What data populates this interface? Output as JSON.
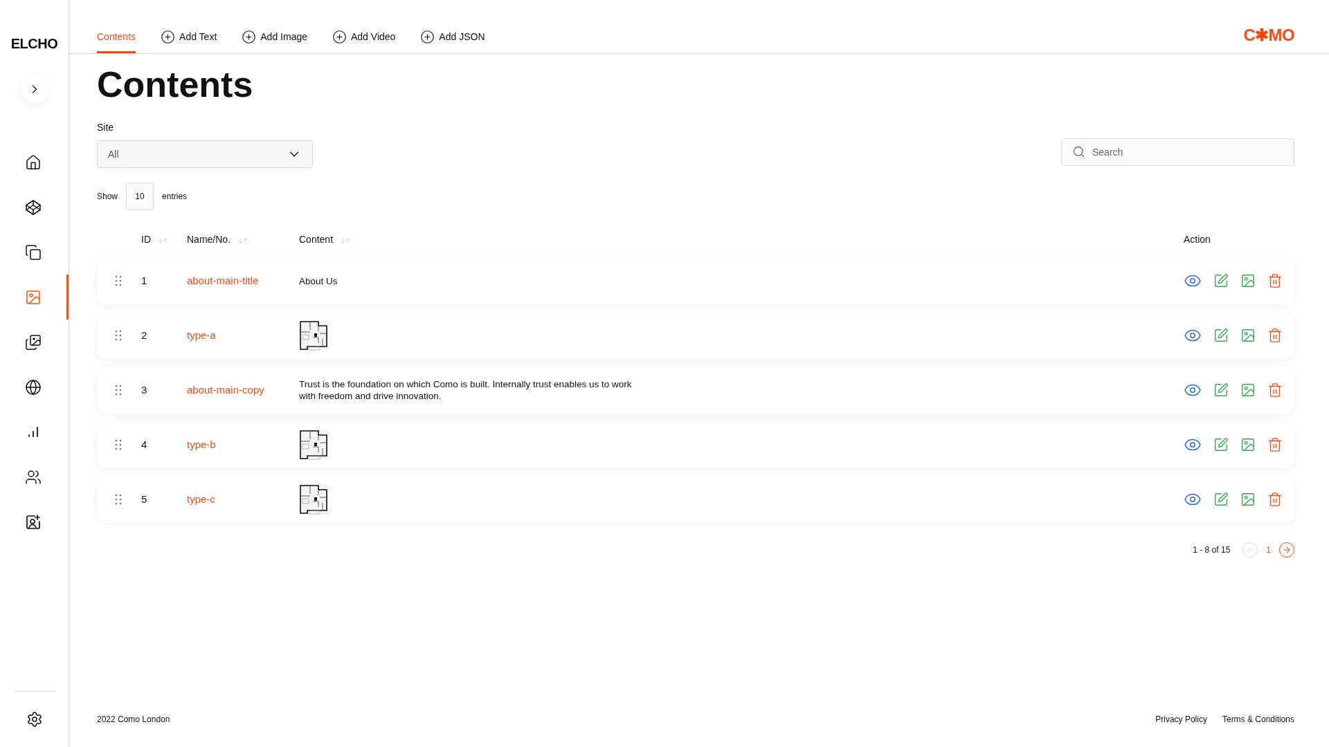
{
  "sidebar": {
    "brand": "ELCHO",
    "items": [
      {
        "selected": false
      },
      {
        "selected": false
      },
      {
        "selected": false
      },
      {
        "selected": true
      },
      {
        "selected": false
      },
      {
        "selected": false
      },
      {
        "selected": false
      },
      {
        "selected": false
      },
      {
        "selected": false
      }
    ]
  },
  "tabs": [
    {
      "label": "Contents",
      "kind": "tab",
      "selected": true
    },
    {
      "label": "Add Text",
      "kind": "add",
      "selected": false
    },
    {
      "label": "Add Image",
      "kind": "add",
      "selected": false
    },
    {
      "label": "Add Video",
      "kind": "add",
      "selected": false
    },
    {
      "label": "Add JSON",
      "kind": "add",
      "selected": false
    }
  ],
  "logo": "C✱MO",
  "page_title": "Contents",
  "site_filter": {
    "label": "Site",
    "value": "All"
  },
  "search": {
    "placeholder": "Search"
  },
  "entries": {
    "prefix": "Show",
    "value": "10",
    "suffix": "entries"
  },
  "table": {
    "columns": [
      {
        "label": "ID",
        "sortable": true
      },
      {
        "label": "Name/No.",
        "sortable": true
      },
      {
        "label": "Content",
        "sortable": true
      },
      {
        "label": "Action",
        "sortable": false
      }
    ],
    "rows": [
      {
        "id": "1",
        "name": "about-main-title",
        "content": {
          "kind": "text",
          "text": "About Us"
        }
      },
      {
        "id": "2",
        "name": "type-a",
        "content": {
          "kind": "image"
        }
      },
      {
        "id": "3",
        "name": "about-main-copy",
        "content": {
          "kind": "text",
          "text": "Trust is the foundation on which Como is built. Internally trust enables us to work with freedom and drive innovation."
        }
      },
      {
        "id": "4",
        "name": "type-b",
        "content": {
          "kind": "image"
        }
      },
      {
        "id": "5",
        "name": "type-c",
        "content": {
          "kind": "image"
        }
      }
    ]
  },
  "pagination": {
    "summary": "1 - 8 of 15",
    "prev_disabled": true,
    "pages": [
      {
        "label": "1",
        "selected": true
      }
    ],
    "next_disabled": false
  },
  "footer": {
    "copyright": "2022 Como London",
    "links": [
      "Privacy Policy",
      "Terms & Conditions"
    ]
  }
}
